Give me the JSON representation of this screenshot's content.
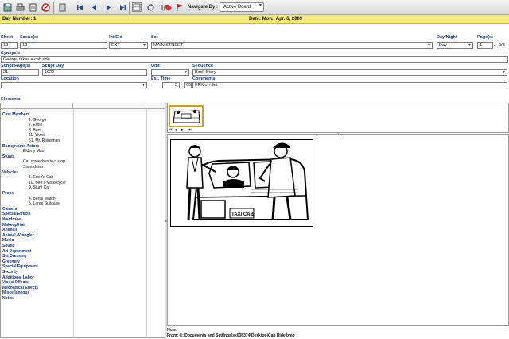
{
  "toolbar": {
    "navigate_label": "Navigate By :",
    "navigate_value": "Active Board",
    "icons": [
      "save-icon",
      "print-icon",
      "report-icon",
      "no-icon",
      "back-icon",
      "first-icon",
      "prev-icon",
      "next-icon",
      "last-icon",
      "board-view-icon",
      "refresh-icon",
      "clip-icon",
      "tag-icon",
      "flag-icon"
    ]
  },
  "day_header": {
    "day": "Day Number: 1",
    "date": "Date: Mon., Apr. 6, 2009"
  },
  "form": {
    "sheet_label": "Sheet",
    "sheet_value": "10",
    "scenes_label": "Scene(s)",
    "scenes_value": "10",
    "intext_label": "Int/Ext",
    "intext_value": "EXT",
    "set_label": "Set",
    "set_value": "MAIN STREET",
    "daynight_label": "Day/Night",
    "daynight_value": "Day",
    "pages_label": "Page(s)",
    "pages_value": "1",
    "pages_frac": "0/8",
    "synopsis_label": "Synopsis",
    "synopsis_value": "George takes a cab ride.",
    "script_pages_label": "Script Page(s)",
    "script_pages_value": "21",
    "script_day_label": "Script Day",
    "script_day_value": "1929",
    "unit_label": "Unit",
    "sequence_label": "Sequence",
    "sequence_value": "Back Story",
    "location_label": "Location",
    "est_time_label": "Est. Time",
    "est_hours": "3",
    "est_sep": ":",
    "est_minutes": "00",
    "comments_label": "Comments",
    "comments_value": "EPK on Set"
  },
  "elements": {
    "title": "Elements",
    "categories": [
      {
        "name": "Cast Members",
        "items": [
          "1. George",
          "7. Ernie",
          "8. Bert",
          "11. Violet",
          "51. Mr. Reinsman"
        ]
      },
      {
        "name": "Background Actors",
        "items": [
          "Elderly Man"
        ]
      },
      {
        "name": "Stunts",
        "items": [
          "Car screeches to a stop",
          "Stunt driver"
        ]
      },
      {
        "name": "Vehicles",
        "items": [
          "1. Ernie's Cab",
          "10. Bert's Motorcycle",
          "9. Stunt Car"
        ]
      },
      {
        "name": "Props",
        "items": [
          "4. Bert's Watch",
          "5. Large Suitcase"
        ]
      },
      {
        "name": "Camera",
        "items": []
      },
      {
        "name": "Special Effects",
        "items": []
      },
      {
        "name": "Wardrobe",
        "items": []
      },
      {
        "name": "Makeup/Hair",
        "items": []
      },
      {
        "name": "Animals",
        "items": []
      },
      {
        "name": "Animal Wrangler",
        "items": []
      },
      {
        "name": "Music",
        "items": []
      },
      {
        "name": "Sound",
        "items": []
      },
      {
        "name": "Art Department",
        "items": []
      },
      {
        "name": "Set Dressing",
        "items": []
      },
      {
        "name": "Greenery",
        "items": []
      },
      {
        "name": "Special Equipment",
        "items": []
      },
      {
        "name": "Security",
        "items": []
      },
      {
        "name": "Additional Labor",
        "items": []
      },
      {
        "name": "Visual Effects",
        "items": []
      },
      {
        "name": "Mechanical Effects",
        "items": []
      },
      {
        "name": "Miscellaneous",
        "items": []
      },
      {
        "name": "Notes",
        "items": []
      }
    ]
  },
  "image_panel": {
    "taxi_sign": "TAXI CAB",
    "note_label": "Note:",
    "from_text": "From: C:\\Documents and Settings\\sk036374\\Desktop\\Cab Ride.bmp"
  },
  "colors": {
    "day_header_bg": "#f2e880",
    "label_blue": "#16337a",
    "thumb_border": "#c9a020"
  }
}
